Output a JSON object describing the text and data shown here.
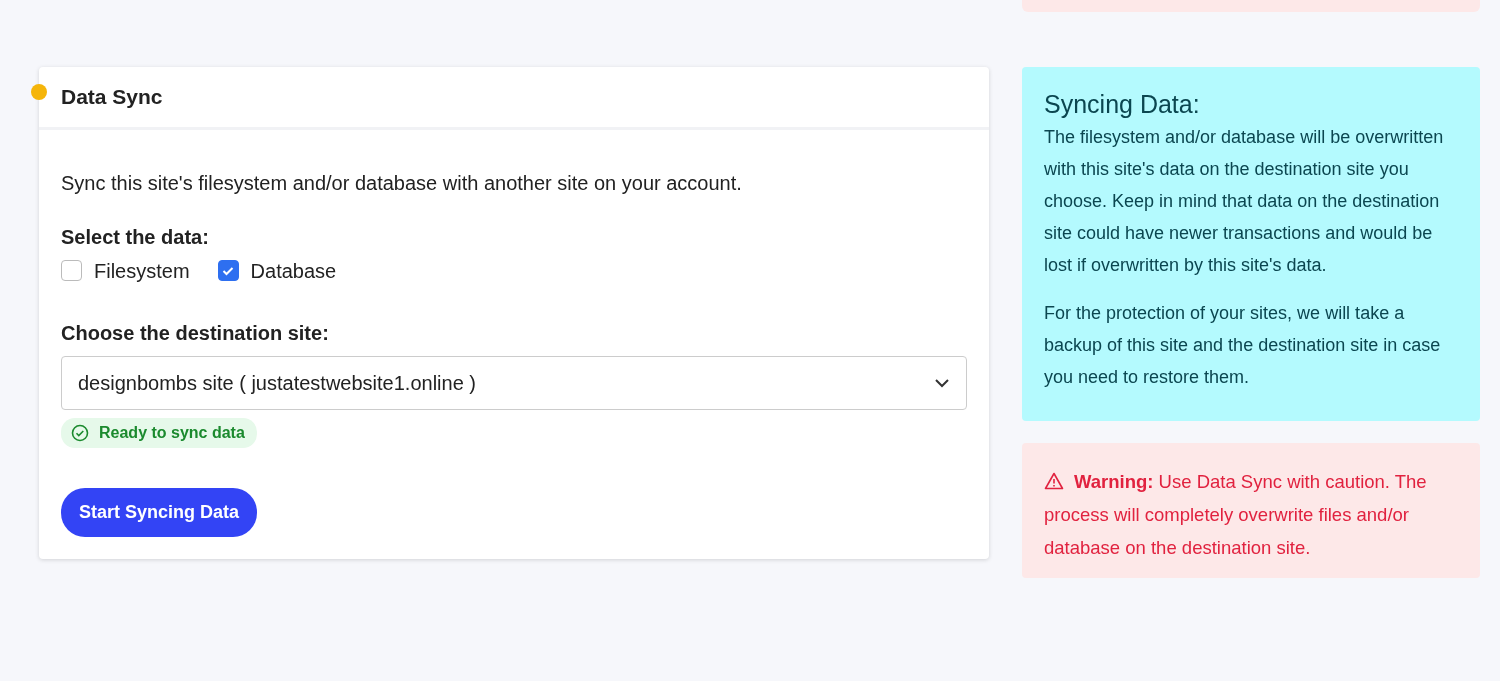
{
  "card": {
    "title": "Data Sync",
    "description": "Sync this site's filesystem and/or database with another site on your account.",
    "data_label": "Select the data:",
    "options": [
      {
        "label": "Filesystem",
        "checked": false
      },
      {
        "label": "Database",
        "checked": true
      }
    ],
    "destination_label": "Choose the destination site:",
    "destination": {
      "value": "designbombs site ( justatestwebsite1.online )"
    },
    "status": "Ready to sync data",
    "button": "Start Syncing Data"
  },
  "info": {
    "title": "Syncing Data:",
    "paragraphs": [
      "The filesystem and/or database will be overwritten with this site's data on the destination site you choose. Keep in mind that data on the destination site could have newer transactions and would be lost if overwritten by this site's data.",
      "For the protection of your sites, we will take a backup of this site and the destination site in case you need to restore them."
    ]
  },
  "warning": {
    "text": "**Warning:** Use Data Sync with caution. The process will completely overwrite files and/or database on the destination site."
  }
}
